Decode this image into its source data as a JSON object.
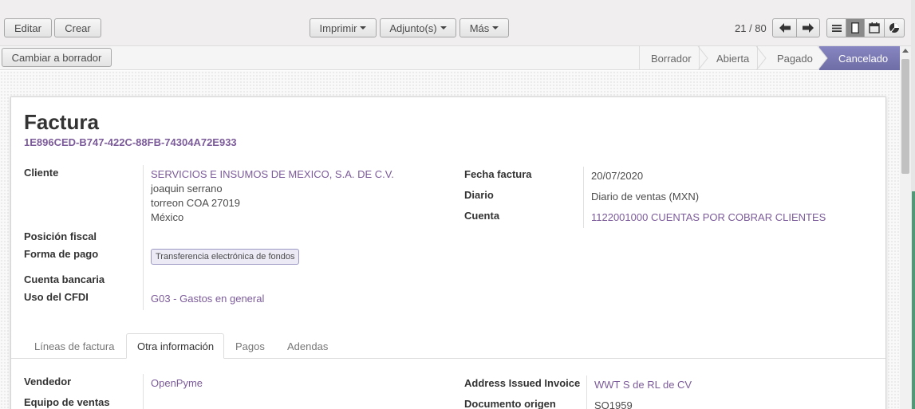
{
  "toolbar": {
    "edit_label": "Editar",
    "create_label": "Crear",
    "print_label": "Imprimir",
    "attachments_label": "Adjunto(s)",
    "more_label": "Más",
    "pager": "21 / 80"
  },
  "statusbar": {
    "reset_label": "Cambiar a borrador",
    "stages": [
      {
        "label": "Borrador"
      },
      {
        "label": "Abierta"
      },
      {
        "label": "Pagado"
      },
      {
        "label": "Cancelado"
      }
    ],
    "active_stage": "Cancelado"
  },
  "invoice": {
    "title": "Factura",
    "uuid": "1E896CED-B747-422C-88FB-74304A72E933"
  },
  "left_fields": {
    "cliente_label": "Cliente",
    "cliente_name": "SERVICIOS E INSUMOS DE MEXICO, S.A. DE C.V.",
    "cliente_contact": "joaquin serrano",
    "cliente_city": "torreon COA 27019",
    "cliente_country": "México",
    "posicion_label": "Posición fiscal",
    "forma_pago_label": "Forma de pago",
    "forma_pago_value": "Transferencia electrónica de fondos",
    "cuenta_bancaria_label": "Cuenta bancaria",
    "uso_cfdi_label": "Uso del CFDI",
    "uso_cfdi_value": "G03 - Gastos en general"
  },
  "right_fields": {
    "fecha_label": "Fecha factura",
    "fecha_value": "20/07/2020",
    "diario_label": "Diario",
    "diario_value": "Diario de ventas (MXN)",
    "cuenta_label": "Cuenta",
    "cuenta_value": "1122001000 CUENTAS POR COBRAR CLIENTES"
  },
  "tabs": [
    {
      "label": "Líneas de factura"
    },
    {
      "label": "Otra información"
    },
    {
      "label": "Pagos"
    },
    {
      "label": "Adendas"
    }
  ],
  "active_tab": "Otra información",
  "other_info": {
    "vendedor_label": "Vendedor",
    "vendedor_value": "OpenPyme",
    "equipo_label": "Equipo de ventas",
    "address_label": "Address Issued Invoice",
    "address_value": "WWT S de RL de CV",
    "origen_label": "Documento origen",
    "origen_value": "SO1959"
  },
  "colors": {
    "accent": "#7c5b9a",
    "active_stage": "#7c7bad"
  },
  "icons": [
    "caret-down-icon",
    "arrow-left-icon",
    "arrow-right-icon",
    "list-view-icon",
    "form-view-icon",
    "calendar-view-icon",
    "graph-view-icon"
  ]
}
